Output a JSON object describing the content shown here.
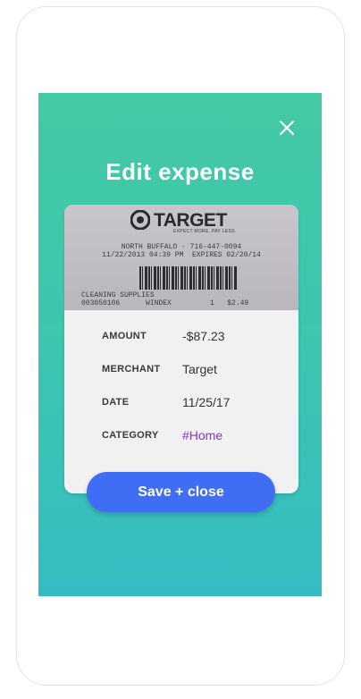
{
  "header": {
    "title": "Edit expense",
    "close_icon": "close-icon"
  },
  "receipt": {
    "brand": "TARGET",
    "slogan": "EXPECT MORE. PAY LESS.",
    "store_line": "NORTH BUFFALO - 716-447-0094",
    "date_line": "11/22/2013 04:39 PM  EXPIRES 02/20/14",
    "section": "CLEANING SUPPLIES",
    "item_line": "003050106      WINDEX         1   $2.49"
  },
  "expense": {
    "fields": [
      {
        "label": "AMOUNT",
        "value": "-$87.23"
      },
      {
        "label": "MERCHANT",
        "value": "Target"
      },
      {
        "label": "DATE",
        "value": "11/25/17"
      },
      {
        "label": "CATEGORY",
        "value": "#Home"
      }
    ]
  },
  "actions": {
    "save_label": "Save + close"
  },
  "colors": {
    "gradient_top": "#43c9a5",
    "gradient_bottom": "#35bcc3",
    "save_button": "#3f6df3",
    "category_text": "#8a2be2"
  }
}
